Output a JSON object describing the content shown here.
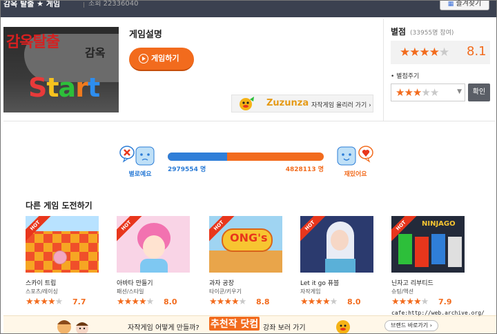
{
  "header": {
    "title": "감옥 탈출 ★ 게임",
    "plays": "조회 22336040",
    "favorite_label": "즐겨찾기",
    "favorite_icon": "grid-icon"
  },
  "game": {
    "thumb_title": "감옥탈출",
    "thumb_sub": "감옥",
    "thumb_start": "Start",
    "description_title": "게임설명",
    "play_label": "게임하기"
  },
  "zuzunza": {
    "brand": "Zuzunza",
    "link": "자작게임 올리러 가기 ›"
  },
  "rating": {
    "title": "별점",
    "count": "(33955명 참여)",
    "score": "8.1",
    "stars_on": 4,
    "give_label": "• 별점주기",
    "give_stars_on": 3,
    "confirm_label": "확인"
  },
  "vote": {
    "bad_label": "별로예요",
    "good_label": "재밌어요",
    "bad_count": "2979554 명",
    "good_count": "4828113 명",
    "bad_fraction": 0.382
  },
  "others": {
    "title": "다른 게임 도전하기",
    "hot_label": "HOT",
    "games": [
      {
        "name": "스카이 트립",
        "category": "스포츠/레이싱",
        "score": "7.7",
        "stars_on": 4
      },
      {
        "name": "아바타 만들기",
        "category": "패션/스타일",
        "score": "8.0",
        "stars_on": 4
      },
      {
        "name": "과자 공장",
        "category": "타이쿤/키우기",
        "score": "8.8",
        "stars_on": 4
      },
      {
        "name": "Let it go 퓨블",
        "category": "자작게임",
        "score": "8.0",
        "stars_on": 4
      },
      {
        "name": "닌자고 리부티드",
        "category": "슈팅/액션",
        "score": "7.9",
        "stars_on": 4
      }
    ]
  },
  "banner": {
    "text1": "자작게임 어떻게 만들까?",
    "highlight": "추천작 닷컴",
    "text2": "강좌 보러 가기",
    "brand_button": "브랜드 바로가기 ›"
  },
  "watermark": "cafe:http://web.archive.org/",
  "colors": {
    "accent": "#f26b1d",
    "blue": "#2f7ed8",
    "topbar": "#3b4150"
  }
}
